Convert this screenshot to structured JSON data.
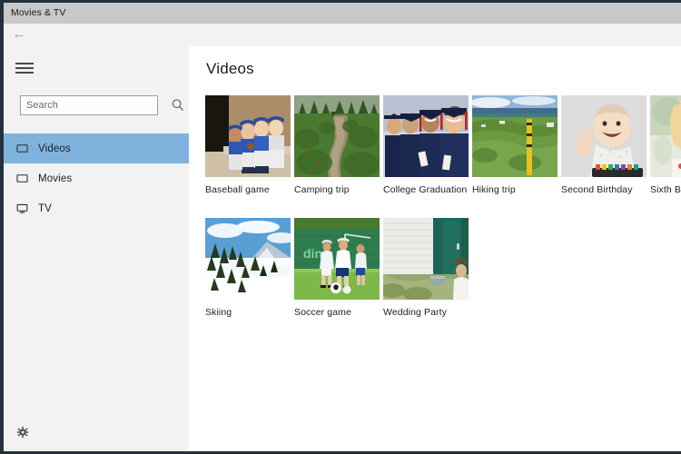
{
  "window": {
    "title": "Movies & TV",
    "back_icon": "back-arrow-icon"
  },
  "sidebar": {
    "menu_icon": "hamburger-icon",
    "search": {
      "value": "",
      "placeholder": "Search",
      "icon": "search-icon"
    },
    "items": [
      {
        "label": "Videos",
        "icon": "video-screen-icon",
        "selected": true
      },
      {
        "label": "Movies",
        "icon": "video-screen-icon",
        "selected": false
      },
      {
        "label": "TV",
        "icon": "tv-monitor-icon",
        "selected": false
      }
    ],
    "settings": {
      "label": "Settings",
      "icon": "gear-icon"
    }
  },
  "main": {
    "title": "Videos",
    "rows": [
      [
        {
          "label": "Baseball game",
          "thumb": "baseball-game-thumbnail"
        },
        {
          "label": "Camping trip",
          "thumb": "camping-trip-thumbnail"
        },
        {
          "label": "College Graduation",
          "thumb": "college-graduation-thumbnail"
        },
        {
          "label": "Hiking trip",
          "thumb": "hiking-trip-thumbnail"
        },
        {
          "label": "Second Birthday",
          "thumb": "second-birthday-thumbnail"
        },
        {
          "label": "Sixth Birthday",
          "thumb": "sixth-birthday-thumbnail"
        }
      ],
      [
        {
          "label": "Skiing",
          "thumb": "skiing-thumbnail"
        },
        {
          "label": "Soccer game",
          "thumb": "soccer-game-thumbnail"
        },
        {
          "label": "Wedding Party",
          "thumb": "wedding-party-thumbnail"
        }
      ]
    ]
  },
  "colors": {
    "titlebar": "#c8c8c8",
    "sidebar": "#f2f2f2",
    "selection": "#7fb3de",
    "content": "#ffffff",
    "text": "#1e1e1e"
  }
}
